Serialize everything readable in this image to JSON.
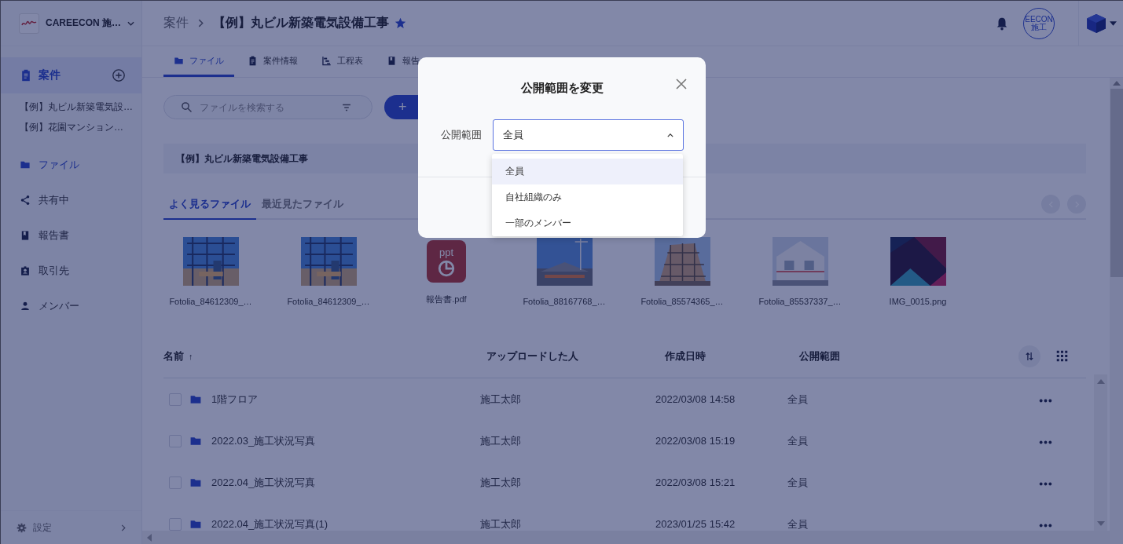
{
  "org": {
    "name": "CAREECON 施…"
  },
  "header": {
    "breadcrumb_parent": "案件",
    "title": "【例】丸ビル新築電気設備工事",
    "starred": true,
    "avatar_text": "EECON 施工"
  },
  "sidebar": {
    "section": {
      "label": "案件",
      "selected": true
    },
    "projects": [
      "【例】丸ビル新築電気設…",
      "【例】花園マンション…"
    ],
    "items": [
      {
        "label": "ファイル",
        "selected": true
      },
      {
        "label": "共有中",
        "selected": false
      },
      {
        "label": "報告書",
        "selected": false
      },
      {
        "label": "取引先",
        "selected": false
      },
      {
        "label": "メンバー",
        "selected": false
      }
    ],
    "settings": "設定"
  },
  "tabs": [
    {
      "label": "ファイル",
      "selected": true
    },
    {
      "label": "案件情報",
      "selected": false
    },
    {
      "label": "工程表",
      "selected": false
    },
    {
      "label": "報告",
      "selected": false
    }
  ],
  "search": {
    "placeholder": "ファイルを検索する"
  },
  "add_button": "+",
  "project_banner": "【例】丸ビル新築電気設備工事",
  "file_tabs": [
    {
      "label": "よく見るファイル",
      "selected": true
    },
    {
      "label": "最近見たファイル",
      "selected": false
    }
  ],
  "recent_files": [
    {
      "name": "Fotolia_84612309_…",
      "kind": "picture"
    },
    {
      "name": "Fotolia_84612309_…",
      "kind": "picture"
    },
    {
      "name": "報告書.pdf",
      "kind": "ppt",
      "badge": "ppt"
    },
    {
      "name": "Fotolia_88167768_…",
      "kind": "picture"
    },
    {
      "name": "Fotolia_85574365_…",
      "kind": "picture"
    },
    {
      "name": "Fotolia_85537337_…",
      "kind": "picture"
    },
    {
      "name": "IMG_0015.png",
      "kind": "picture"
    }
  ],
  "table": {
    "columns": [
      "名前",
      "アップロードした人",
      "作成日時",
      "公開範囲"
    ],
    "sort_mark": "↑",
    "rows": [
      {
        "name": "1階フロア",
        "uploader": "施工太郎",
        "created": "2022/03/08 14:58",
        "scope": "全員",
        "checked": false
      },
      {
        "name": "2022.03_施工状況写真",
        "uploader": "施工太郎",
        "created": "2022/03/08 15:19",
        "scope": "全員",
        "checked": false
      },
      {
        "name": "2022.04_施工状況写真",
        "uploader": "施工太郎",
        "created": "2022/03/08 15:21",
        "scope": "全員",
        "checked": false
      },
      {
        "name": "2022.04_施工状況写真(1)",
        "uploader": "施工太郎",
        "created": "2023/01/25 15:42",
        "scope": "全員",
        "checked": false
      }
    ]
  },
  "modal": {
    "title": "公開範囲を変更",
    "field_label": "公開範囲",
    "value": "全員",
    "expanded": true,
    "options": [
      {
        "label": "全員",
        "selected": true
      },
      {
        "label": "自社組織のみ",
        "selected": false
      },
      {
        "label": "一部のメンバー",
        "selected": false
      }
    ]
  }
}
